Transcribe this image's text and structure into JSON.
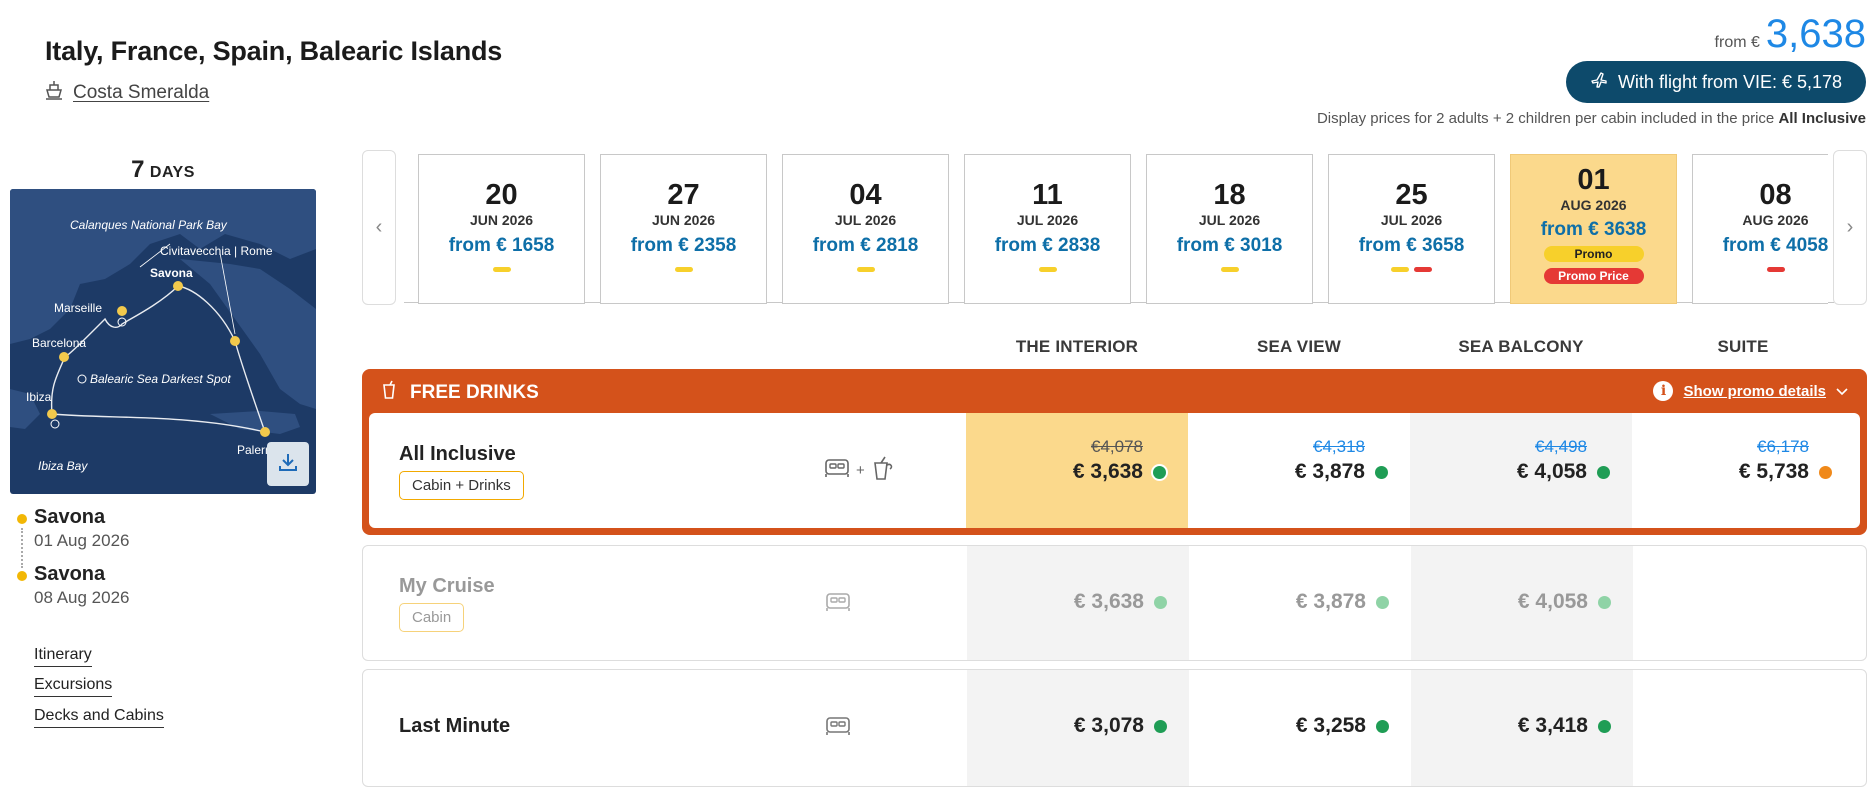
{
  "header": {
    "title": "Italy, France, Spain, Balearic Islands",
    "ship_name": "Costa Smeralda",
    "from_label": "from €",
    "from_price": "3,638",
    "flight_button": "With flight from VIE: € 5,178",
    "disclaimer_prefix": "Display prices for 2 adults + 2 children per cabin included in the price",
    "disclaimer_bold": "All Inclusive"
  },
  "trip": {
    "days_number": "7",
    "days_label": "DAYS",
    "map_labels": {
      "calanques": "Calanques National Park Bay",
      "civitavecchia": "Civitavecchia | Rome",
      "savona": "Savona",
      "marseille": "Marseille",
      "barcelona": "Barcelona",
      "balearic": "Balearic Sea Darkest Spot",
      "ibiza": "Ibiza",
      "ibiza_bay": "Ibiza Bay",
      "palermo": "Palermo"
    },
    "departure_port": "Savona",
    "departure_date": "01 Aug 2026",
    "arrival_port": "Savona",
    "arrival_date": "08 Aug 2026",
    "links": [
      "Itinerary",
      "Excursions",
      "Decks and Cabins"
    ]
  },
  "dates": [
    {
      "day": "20",
      "month": "JUN 2026",
      "price": "from € 1658",
      "marks": [
        "y"
      ],
      "selected": false
    },
    {
      "day": "27",
      "month": "JUN 2026",
      "price": "from € 2358",
      "marks": [
        "y"
      ],
      "selected": false
    },
    {
      "day": "04",
      "month": "JUL 2026",
      "price": "from € 2818",
      "marks": [
        "y"
      ],
      "selected": false
    },
    {
      "day": "11",
      "month": "JUL 2026",
      "price": "from € 2838",
      "marks": [
        "y"
      ],
      "selected": false
    },
    {
      "day": "18",
      "month": "JUL 2026",
      "price": "from € 3018",
      "marks": [
        "y"
      ],
      "selected": false
    },
    {
      "day": "25",
      "month": "JUL 2026",
      "price": "from € 3658",
      "marks": [
        "y",
        "r"
      ],
      "selected": false
    },
    {
      "day": "01",
      "month": "AUG 2026",
      "price": "from € 3638",
      "marks": [],
      "selected": true,
      "pills": [
        "Promo",
        "Promo Price"
      ]
    },
    {
      "day": "08",
      "month": "AUG 2026",
      "price": "from € 4058",
      "marks": [
        "r"
      ],
      "selected": false
    }
  ],
  "cabin_types": [
    "THE INTERIOR",
    "SEA VIEW",
    "SEA BALCONY",
    "SUITE"
  ],
  "promo": {
    "title": "FREE DRINKS",
    "details_link": "Show promo details"
  },
  "fares": [
    {
      "name": "All Inclusive",
      "badge": "Cabin + Drinks",
      "prices": [
        {
          "old": "€4,078",
          "value": "€ 3,638",
          "status": "green"
        },
        {
          "old": "€4,318",
          "value": "€ 3,878",
          "status": "green"
        },
        {
          "old": "€4,498",
          "value": "€ 4,058",
          "status": "green"
        },
        {
          "old": "€6,178",
          "value": "€ 5,738",
          "status": "orange"
        }
      ]
    },
    {
      "name": "My Cruise",
      "badge": "Cabin",
      "prices": [
        {
          "value": "€ 3,638",
          "status": "green-light"
        },
        {
          "value": "€ 3,878",
          "status": "green-light"
        },
        {
          "value": "€ 4,058",
          "status": "green-light"
        }
      ]
    },
    {
      "name": "Last Minute",
      "prices": [
        {
          "value": "€ 3,078",
          "status": "green"
        },
        {
          "value": "€ 3,258",
          "status": "green"
        },
        {
          "value": "€ 3,418",
          "status": "green"
        }
      ]
    }
  ],
  "colors": {
    "accent_blue": "#1e88e5",
    "promo_orange": "#d4521b",
    "selected_yellow": "#fbd98c",
    "status_green": "#1f9d55",
    "status_orange": "#f0891a"
  }
}
